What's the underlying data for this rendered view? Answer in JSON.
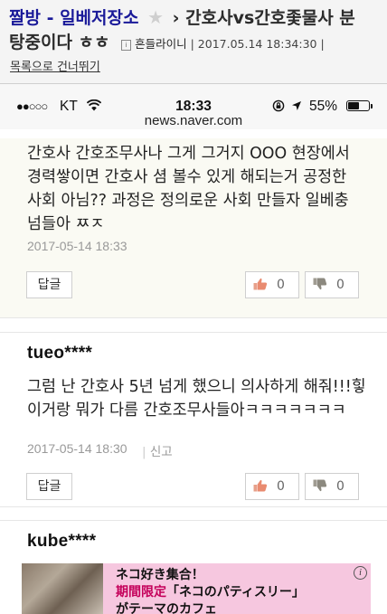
{
  "header": {
    "board_name": "짤방 - 일베저장소",
    "separator": "›",
    "post_title_line1": "간호사vs간호좇물사 분",
    "post_title_line2": "탕중이다 ㅎㅎ",
    "author": "흔들라이니",
    "meta_datetime": "| 2017.05.14 18:34:30 |",
    "skip_link": "목록으로 건너뛰기"
  },
  "status_bar": {
    "signal_dots": "●●○○○",
    "carrier": "KT",
    "time": "18:33",
    "battery_pct": "55%",
    "battery_level": 0.55
  },
  "url": "news.naver.com",
  "comments": [
    {
      "username": "",
      "text": "간호사 간호조무사나 그게 그거지 OOO 현장에서 경력쌓이면 간호사 셤 볼수 있게 해되는거 공정한 사회 아님?? 과정은 정의로운 사회 만들자 일베충 넘들아 ㅉㅈ",
      "date": "2017-05-14 18:33",
      "report": "",
      "reply_label": "답글",
      "likes": "0",
      "dislikes": "0"
    },
    {
      "username": "tueo****",
      "text": "그럼 난 간호사 5년 넘게 했으니 의사하게 해줘!!!힣 이거랑 뭐가 다름 간호조무사들아ㅋㅋㅋㅋㅋㅋㅋ",
      "date": "2017-05-14 18:30",
      "report": "신고",
      "reply_label": "답글",
      "likes": "0",
      "dislikes": "0"
    },
    {
      "username": "kube****"
    }
  ],
  "ad": {
    "line1": "ネコ好き集合！",
    "line2_highlight": "期間限定",
    "line2_rest": "「ネコのパティスリー」",
    "line3": "がテーマのカフェ",
    "info_symbol": "i"
  }
}
